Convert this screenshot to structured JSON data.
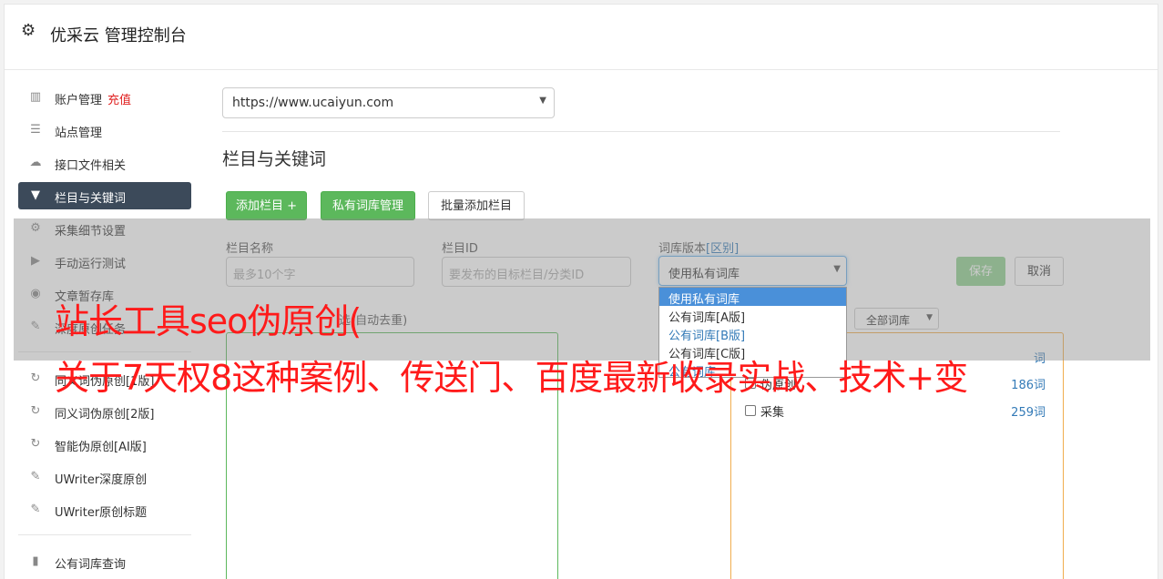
{
  "header": {
    "title": "优采云 管理控制台",
    "icon": "gear-icon"
  },
  "sidebar": {
    "items": [
      {
        "label": "账户管理",
        "tag": "充值",
        "icon": "bar-chart-icon"
      },
      {
        "label": "站点管理",
        "icon": "server-icon"
      },
      {
        "label": "接口文件相关",
        "icon": "cloud-upload-icon"
      },
      {
        "label": "栏目与关键词",
        "icon": "filter-icon",
        "active": true
      },
      {
        "label": "采集细节设置",
        "icon": "cogs-icon"
      },
      {
        "label": "手动运行测试",
        "icon": "play-circle-icon"
      },
      {
        "label": "文章暂存库",
        "icon": "database-icon"
      },
      {
        "label": "深度原创任务",
        "icon": "edit-icon"
      },
      {
        "label": "同义词伪原创[1版]",
        "icon": "refresh-icon"
      },
      {
        "label": "同义词伪原创[2版]",
        "icon": "refresh-icon"
      },
      {
        "label": "智能伪原创[AI版]",
        "icon": "refresh-icon"
      },
      {
        "label": "UWriter深度原创",
        "icon": "edit-icon"
      },
      {
        "label": "UWriter原创标题",
        "icon": "edit-icon"
      },
      {
        "label": "公有词库查询",
        "icon": "book-icon"
      }
    ]
  },
  "main": {
    "site_select": "https://www.ucaiyun.com",
    "section_title": "栏目与关键词",
    "buttons": {
      "add_column": "添加栏目 +",
      "private_lib": "私有词库管理",
      "batch_add": "批量添加栏目"
    },
    "form": {
      "name_label": "栏目名称",
      "name_placeholder": "最多10个字",
      "id_label": "栏目ID",
      "id_placeholder": "要发布的目标栏目/分类ID",
      "lib_label": "词库版本",
      "lib_label_link": "[区别]",
      "lib_value": "使用私有词库",
      "save": "保存",
      "cancel": "取消"
    },
    "dropdown_options": [
      {
        "label": "使用私有词库",
        "selected": true
      },
      {
        "label": "公有词库[A版]"
      },
      {
        "label": "公有词库[B版]",
        "blue": true
      },
      {
        "label": "公有词库[C版]"
      },
      {
        "label": "公有词库"
      }
    ],
    "left_box_label": "选(自动去重)",
    "right_filter": "全部词库",
    "libraries": [
      {
        "name": "",
        "count": "词"
      },
      {
        "name": "伪原创",
        "count": "186词"
      },
      {
        "name": "采集",
        "count": "259词"
      }
    ]
  },
  "ad": {
    "line1": "站长工具seo伪原创(",
    "line2": "关于7天权8这种案例、传送门、百度最新收录实战、技术+变"
  }
}
